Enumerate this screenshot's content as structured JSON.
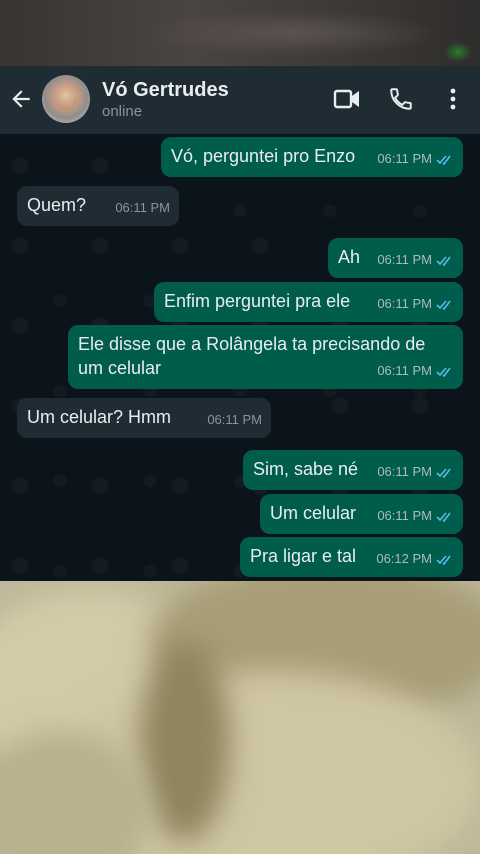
{
  "contact": {
    "name": "Vó Gertrudes",
    "status": "online"
  },
  "colors": {
    "header_bg": "#1f2c33",
    "chat_bg": "#0b141a",
    "outgoing_bubble": "#005c4b",
    "incoming_bubble": "#1f2c33",
    "read_tick": "#53bdeb"
  },
  "header_icons": [
    "back-arrow-icon",
    "video-call-icon",
    "phone-call-icon",
    "more-vertical-icon"
  ],
  "messages": [
    {
      "direction": "out",
      "text": "Vó, perguntei pro Enzo",
      "time": "06:11 PM",
      "read": true
    },
    {
      "direction": "in",
      "text": "Quem?",
      "time": "06:11 PM"
    },
    {
      "direction": "out",
      "text": "Ah",
      "time": "06:11 PM",
      "read": true
    },
    {
      "direction": "out",
      "text": "Enfim perguntei pra ele",
      "time": "06:11 PM",
      "read": true
    },
    {
      "direction": "out",
      "text": "Ele disse que a Rolângela ta precisando de\num celular",
      "time": "06:11 PM",
      "read": true
    },
    {
      "direction": "in",
      "text": "Um celular? Hmm",
      "time": "06:11 PM"
    },
    {
      "direction": "out",
      "text": "Sim, sabe né",
      "time": "06:11 PM",
      "read": true
    },
    {
      "direction": "out",
      "text": "Um celular",
      "time": "06:11 PM",
      "read": true
    },
    {
      "direction": "out",
      "text": "Pra ligar e tal",
      "time": "06:12 PM",
      "read": true
    }
  ]
}
